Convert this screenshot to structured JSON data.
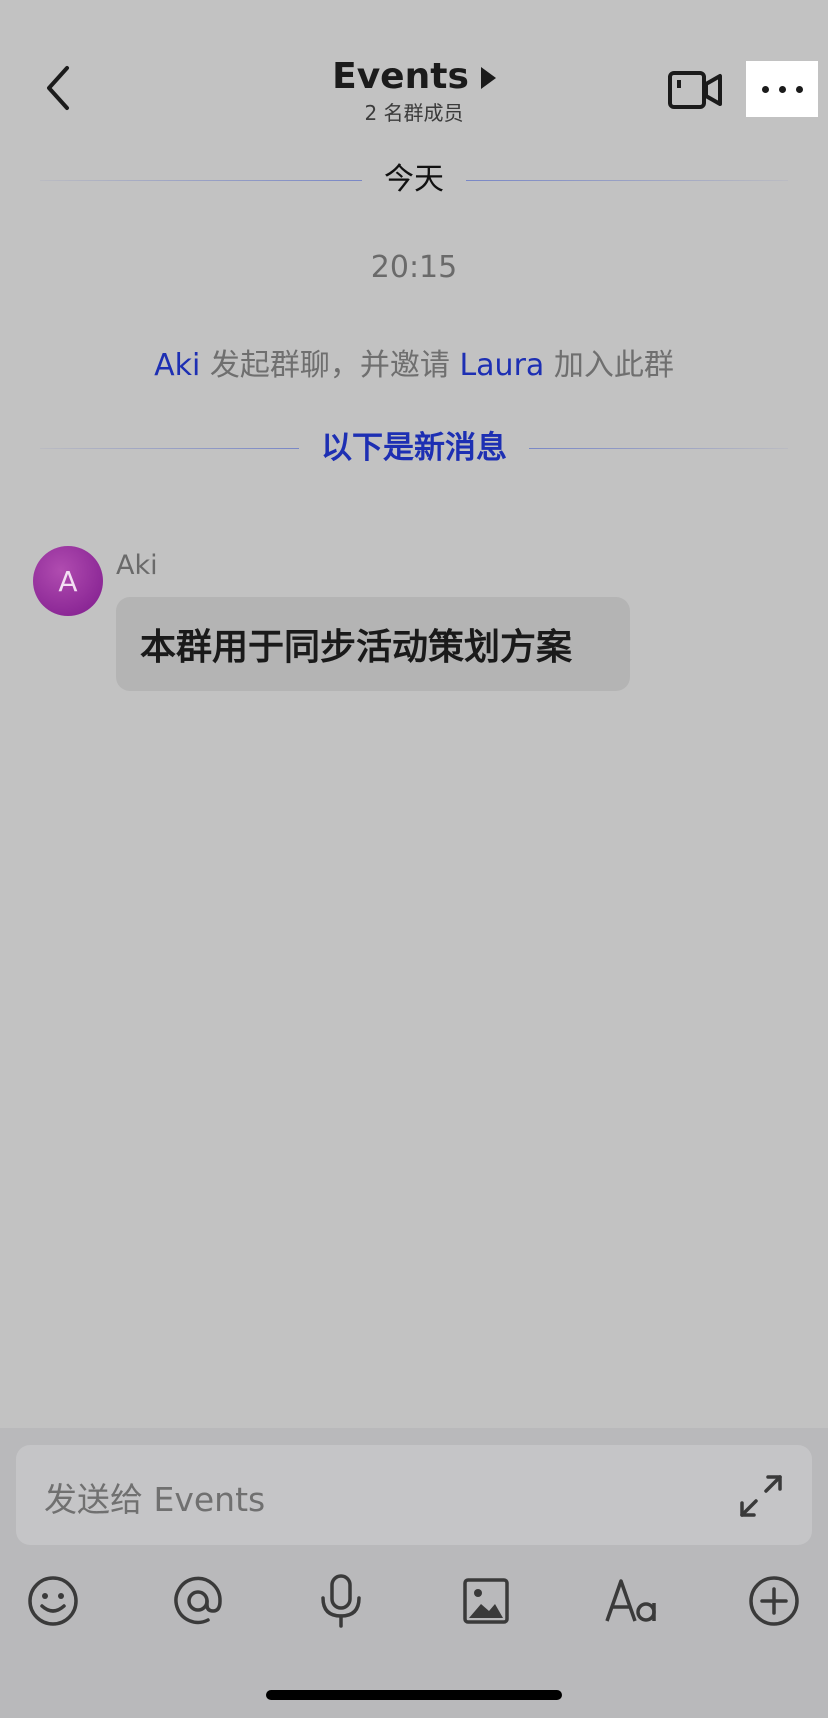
{
  "header": {
    "title": "Events",
    "subtitle": "2 名群成员"
  },
  "chat": {
    "date_divider": "今天",
    "time": "20:15",
    "system_message": {
      "actor": "Aki",
      "text_part1": " 发起群聊，并邀请 ",
      "invitee": "Laura",
      "text_part2": " 加入此群"
    },
    "new_messages_divider": "以下是新消息",
    "messages": [
      {
        "sender": "Aki",
        "avatar_initial": "A",
        "text": "本群用于同步活动策划方案"
      }
    ]
  },
  "composer": {
    "placeholder": "发送给 Events"
  },
  "toolbar_icons": [
    "emoji-icon",
    "at-icon",
    "microphone-icon",
    "image-icon",
    "text-format-icon",
    "plus-icon"
  ],
  "colors": {
    "background": "#c2c2c2",
    "mention": "#1d2fb3",
    "avatar": "#8e2a98"
  }
}
